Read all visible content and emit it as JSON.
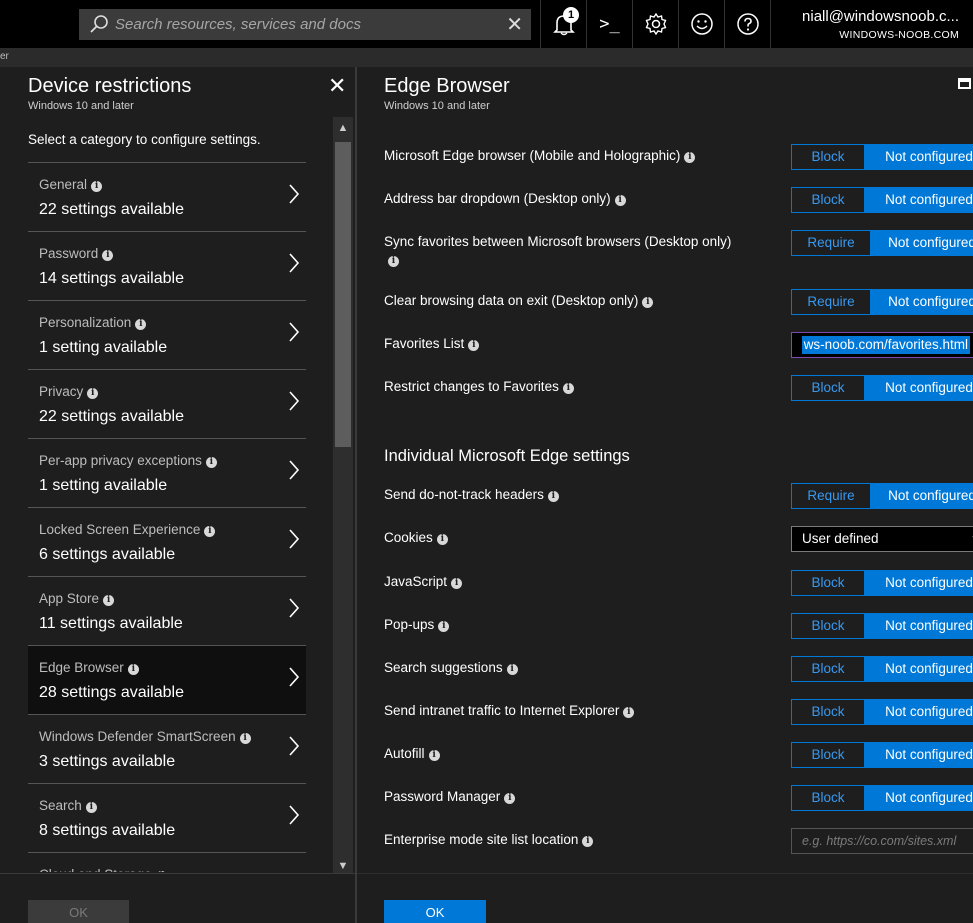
{
  "topbar": {
    "search_placeholder": "Search resources, services and docs",
    "clear_glyph": "✕",
    "notification_count": "1",
    "cloud_shell_glyph": ">_",
    "user_name": "niall@windowsnoob.c...",
    "tenant": "WINDOWS-NOOB.COM"
  },
  "breadcrumb": "er",
  "left_blade": {
    "title": "Device restrictions",
    "subtitle": "Windows 10 and later",
    "close_glyph": "✕",
    "hint": "Select a category to configure settings.",
    "categories": [
      {
        "name": "General",
        "count": "22 settings available"
      },
      {
        "name": "Password",
        "count": "14 settings available"
      },
      {
        "name": "Personalization",
        "count": "1 setting available"
      },
      {
        "name": "Privacy",
        "count": "22 settings available"
      },
      {
        "name": "Per-app privacy exceptions",
        "count": "1 setting available"
      },
      {
        "name": "Locked Screen Experience",
        "count": "6 settings available"
      },
      {
        "name": "App Store",
        "count": "11 settings available"
      },
      {
        "name": "Edge Browser",
        "count": "28 settings available"
      },
      {
        "name": "Windows Defender SmartScreen",
        "count": "3 settings available"
      },
      {
        "name": "Search",
        "count": "8 settings available"
      },
      {
        "name": "Cloud and Storage",
        "count": ""
      }
    ],
    "selected_index": 7,
    "ok_label": "OK"
  },
  "right_blade": {
    "title": "Edge Browser",
    "subtitle": "Windows 10 and later",
    "settings": [
      {
        "label": "Microsoft Edge browser (Mobile and Holographic)",
        "opt1": "Block",
        "opt2": "Not configured"
      },
      {
        "label": "Address bar dropdown (Desktop only)",
        "opt1": "Block",
        "opt2": "Not configured"
      },
      {
        "label": "Sync favorites between Microsoft browsers (Desktop only)",
        "opt1": "Require",
        "opt2": "Not configured"
      },
      {
        "label": "Clear browsing data on exit (Desktop only)",
        "opt1": "Require",
        "opt2": "Not configured"
      },
      {
        "label": "Favorites List",
        "value": "ws-noob.com/favorites.html"
      },
      {
        "label": "Restrict changes to Favorites",
        "opt1": "Block",
        "opt2": "Not configured"
      }
    ],
    "section_heading": "Individual Microsoft Edge settings",
    "individual": [
      {
        "label": "Send do-not-track headers",
        "opt1": "Require",
        "opt2": "Not configured"
      },
      {
        "label": "Cookies",
        "dropdown": "User defined"
      },
      {
        "label": "JavaScript",
        "opt1": "Block",
        "opt2": "Not configured"
      },
      {
        "label": "Pop-ups",
        "opt1": "Block",
        "opt2": "Not configured"
      },
      {
        "label": "Search suggestions",
        "opt1": "Block",
        "opt2": "Not configured"
      },
      {
        "label": "Send intranet traffic to Internet Explorer",
        "opt1": "Block",
        "opt2": "Not configured"
      },
      {
        "label": "Autofill",
        "opt1": "Block",
        "opt2": "Not configured"
      },
      {
        "label": "Password Manager",
        "opt1": "Block",
        "opt2": "Not configured"
      },
      {
        "label": "Enterprise mode site list location",
        "placeholder": "e.g. https://co.com/sites.xml"
      }
    ],
    "ok_label": "OK"
  },
  "colors": {
    "accent": "#0078d7",
    "background": "#1e1e1e",
    "topbar": "#000000"
  }
}
